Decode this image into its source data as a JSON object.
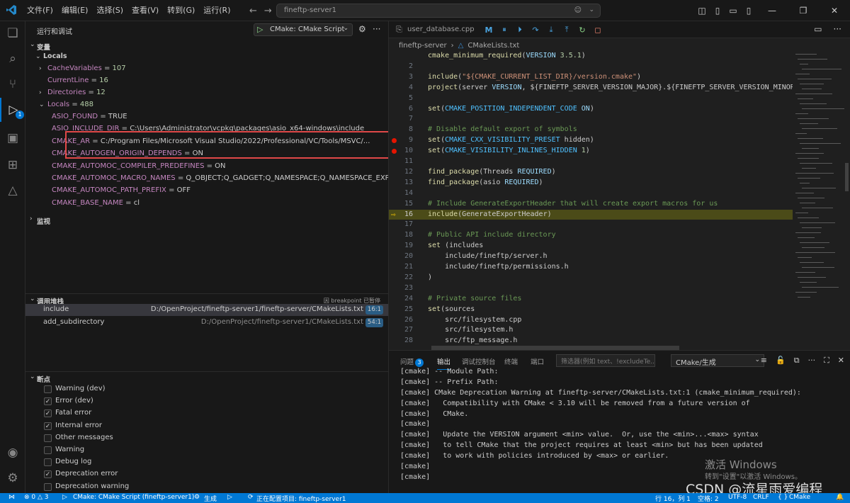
{
  "titlebar": {
    "menus": [
      "文件(F)",
      "编辑(E)",
      "选择(S)",
      "查看(V)",
      "转到(G)",
      "运行(R)"
    ],
    "search_text": "fineftp-server1"
  },
  "activity": {
    "debug_badge": "1"
  },
  "sidebar": {
    "title": "运行和调试",
    "run_config": "CMake: CMake Script",
    "variables_header": "变量",
    "locals_header": "Locals",
    "vars": [
      {
        "name": "CacheVariables",
        "sep": " = ",
        "value": "107"
      },
      {
        "name": "CurrentLine",
        "sep": " = ",
        "value": "16"
      },
      {
        "name": "Directories",
        "sep": " = ",
        "value": "12"
      },
      {
        "name": "Locals",
        "sep": " = ",
        "value": "488"
      }
    ],
    "locals": [
      {
        "name": "ASIO_FOUND",
        "sep": " = ",
        "value": "TRUE"
      },
      {
        "name": "ASIO_INCLUDE_DIR",
        "sep": " = ",
        "value": "C:\\Users\\Administrator\\vcpkg\\packages\\asio_x64-windows\\include"
      },
      {
        "name": "CMAKE_AR",
        "sep": " = ",
        "value": "C:/Program Files/Microsoft Visual Studio/2022/Professional/VC/Tools/MSVC/..."
      },
      {
        "name": "CMAKE_AUTOGEN_ORIGIN_DEPENDS",
        "sep": " = ",
        "value": "ON"
      },
      {
        "name": "CMAKE_AUTOMOC_COMPILER_PREDEFINES",
        "sep": " = ",
        "value": "ON"
      },
      {
        "name": "CMAKE_AUTOMOC_MACRO_NAMES",
        "sep": " = ",
        "value": "Q_OBJECT;Q_GADGET;Q_NAMESPACE;Q_NAMESPACE_EXPORT"
      },
      {
        "name": "CMAKE_AUTOMOC_PATH_PREFIX",
        "sep": " = ",
        "value": "OFF"
      },
      {
        "name": "CMAKE_BASE_NAME",
        "sep": " = ",
        "value": "cl"
      }
    ],
    "watch_header": "监视",
    "callstack_header": "调用堆栈",
    "callstack_status": "因 breakpoint 已暂停",
    "stack": [
      {
        "fn": "include",
        "path": "D:/OpenProject/fineftp-server1/fineftp-server/CMakeLists.txt",
        "pos": "16:1"
      },
      {
        "fn": "add_subdirectory",
        "path": "D:/OpenProject/fineftp-server1/CMakeLists.txt",
        "pos": "54:1"
      }
    ],
    "breakpoints_header": "断点",
    "breakpoints": [
      {
        "label": "Warning (dev)",
        "checked": false
      },
      {
        "label": "Error (dev)",
        "checked": true
      },
      {
        "label": "Fatal error",
        "checked": true
      },
      {
        "label": "Internal error",
        "checked": true
      },
      {
        "label": "Other messages",
        "checked": false
      },
      {
        "label": "Warning",
        "checked": false
      },
      {
        "label": "Debug log",
        "checked": false
      },
      {
        "label": "Deprecation error",
        "checked": true
      },
      {
        "label": "Deprecation warning",
        "checked": false
      }
    ]
  },
  "editor": {
    "tab": "user_database.cpp",
    "tab_active": "CMakeLists.txt",
    "breadcrumb": [
      "fineftp-server",
      "CMakeLists.txt"
    ],
    "lines": [
      {
        "n": "",
        "parts": [
          [
            "kw",
            "cmake_minimum_required"
          ],
          [
            "",
            "("
          ],
          [
            "arg",
            "VERSION"
          ],
          [
            "",
            " "
          ],
          [
            "num",
            "3.5.1"
          ],
          [
            "",
            ")"
          ]
        ]
      },
      {
        "n": "2",
        "parts": []
      },
      {
        "n": "3",
        "parts": [
          [
            "kw",
            "include"
          ],
          [
            "",
            "("
          ],
          [
            "str",
            "\"${CMAKE_CURRENT_LIST_DIR}/version.cmake\""
          ],
          [
            "",
            ")"
          ]
        ]
      },
      {
        "n": "4",
        "parts": [
          [
            "kw",
            "project"
          ],
          [
            "",
            "(server "
          ],
          [
            "arg",
            "VERSION"
          ],
          [
            "",
            ", ${FINEFTP_SERVER_VERSION_MAJOR}.${FINEFTP_SERVER_VERSION_MINOR"
          ]
        ]
      },
      {
        "n": "5",
        "parts": []
      },
      {
        "n": "6",
        "parts": [
          [
            "kw",
            "set"
          ],
          [
            "",
            "("
          ],
          [
            "vr",
            "CMAKE_POSITION_INDEPENDENT_CODE"
          ],
          [
            "",
            " "
          ],
          [
            "arg",
            "ON"
          ],
          [
            "",
            ")"
          ]
        ]
      },
      {
        "n": "7",
        "parts": []
      },
      {
        "n": "8",
        "parts": [
          [
            "cm",
            "# Disable default export of symbols"
          ]
        ]
      },
      {
        "n": "9",
        "parts": [
          [
            "kw",
            "set"
          ],
          [
            "",
            "("
          ],
          [
            "vr",
            "CMAKE_CXX_VISIBILITY_PRESET"
          ],
          [
            "",
            " hidden)"
          ]
        ],
        "dot": true
      },
      {
        "n": "10",
        "parts": [
          [
            "kw",
            "set"
          ],
          [
            "",
            "("
          ],
          [
            "vr",
            "CMAKE_VISIBILITY_INLINES_HIDDEN"
          ],
          [
            "",
            " "
          ],
          [
            "num",
            "1"
          ],
          [
            "",
            ")"
          ]
        ],
        "dot": true
      },
      {
        "n": "11",
        "parts": []
      },
      {
        "n": "12",
        "parts": [
          [
            "kw",
            "find_package"
          ],
          [
            "",
            "(Threads "
          ],
          [
            "arg",
            "REQUIRED"
          ],
          [
            "",
            ")"
          ]
        ]
      },
      {
        "n": "13",
        "parts": [
          [
            "kw",
            "find_package"
          ],
          [
            "",
            "(asio "
          ],
          [
            "arg",
            "REQUIRED"
          ],
          [
            "",
            ")"
          ]
        ]
      },
      {
        "n": "14",
        "parts": []
      },
      {
        "n": "15",
        "parts": [
          [
            "cm",
            "# Include GenerateExportHeader that will create export macros for us"
          ]
        ]
      },
      {
        "n": "16",
        "parts": [
          [
            "kw",
            "include"
          ],
          [
            "",
            "(GenerateExportHeader)"
          ]
        ],
        "current": true
      },
      {
        "n": "17",
        "parts": []
      },
      {
        "n": "18",
        "parts": [
          [
            "cm",
            "# Public API include directory"
          ]
        ]
      },
      {
        "n": "19",
        "parts": [
          [
            "kw",
            "set"
          ],
          [
            "",
            " (includes"
          ]
        ]
      },
      {
        "n": "20",
        "parts": [
          [
            "",
            "    include/fineftp/server.h"
          ]
        ]
      },
      {
        "n": "21",
        "parts": [
          [
            "",
            "    include/fineftp/permissions.h"
          ]
        ]
      },
      {
        "n": "22",
        "parts": [
          [
            "",
            ")"
          ]
        ]
      },
      {
        "n": "23",
        "parts": []
      },
      {
        "n": "24",
        "parts": [
          [
            "cm",
            "# Private source files"
          ]
        ]
      },
      {
        "n": "25",
        "parts": [
          [
            "kw",
            "set"
          ],
          [
            "",
            "(sources"
          ]
        ]
      },
      {
        "n": "26",
        "parts": [
          [
            "",
            "    src/filesystem.cpp"
          ]
        ]
      },
      {
        "n": "27",
        "parts": [
          [
            "",
            "    src/filesystem.h"
          ]
        ]
      },
      {
        "n": "28",
        "parts": [
          [
            "",
            "    src/ftp_message.h"
          ]
        ]
      }
    ]
  },
  "panel": {
    "tabs": [
      {
        "label": "问题",
        "count": "3"
      },
      {
        "label": "输出",
        "active": true
      },
      {
        "label": "调试控制台"
      },
      {
        "label": "终端"
      },
      {
        "label": "端口"
      }
    ],
    "filter_placeholder": "筛选器(例如 text、!excludeTe...",
    "output_channel": "CMake/生成",
    "output": [
      "[cmake] -- Module Path:",
      "[cmake] -- Prefix Path:",
      "[cmake] CMake Deprecation Warning at fineftp-server/CMakeLists.txt:1 (cmake_minimum_required):",
      "[cmake]   Compatibility with CMake < 3.10 will be removed from a future version of",
      "[cmake]   CMake.",
      "[cmake]",
      "[cmake]   Update the VERSION argument <min> value.  Or, use the <min>...<max> syntax",
      "[cmake]   to tell CMake that the project requires at least <min> but has been updated",
      "[cmake]   to work with policies introduced by <max> or earlier.",
      "[cmake]",
      "[cmake]"
    ]
  },
  "watermark": {
    "activate": "激活 Windows",
    "activate_sub": "转到\"设置\"以激活 Windows。",
    "csdn": "CSDN @流星雨爱编程"
  },
  "status": {
    "problems": "⊗ 0 △ 3",
    "debug_config": "CMake: CMake Script (fineftp-server1)",
    "build": "生成",
    "configuring": "正在配置项目: fineftp-server1",
    "position": "行 16，列 1",
    "spaces": "空格: 2",
    "encoding": "UTF-8",
    "eol": "CRLF",
    "language": "CMake"
  }
}
